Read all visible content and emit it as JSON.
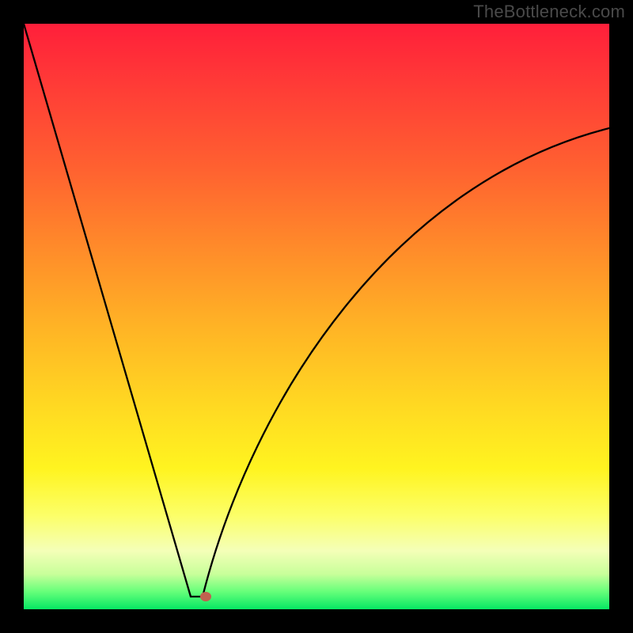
{
  "watermark": "TheBottleneck.com",
  "chart_data": {
    "type": "line",
    "title": "",
    "xlabel": "",
    "ylabel": "",
    "x": [
      0.0,
      0.05,
      0.1,
      0.15,
      0.2,
      0.25,
      0.28,
      0.3,
      0.32,
      0.35,
      0.4,
      0.45,
      0.5,
      0.55,
      0.6,
      0.65,
      0.7,
      0.75,
      0.8,
      0.85,
      0.9,
      0.95,
      1.0
    ],
    "values": [
      100,
      82,
      64,
      46,
      28,
      10,
      2,
      0,
      2,
      11,
      25,
      36,
      45,
      53,
      59,
      64,
      68,
      72,
      75,
      77,
      79,
      80.5,
      82
    ],
    "xlim": [
      0,
      1
    ],
    "ylim": [
      0,
      100
    ],
    "min_flat": {
      "x_start": 0.285,
      "x_end": 0.305,
      "y": 0
    },
    "marker": {
      "x": 0.31,
      "y": 0.5
    },
    "gradient_stops": [
      {
        "pct": 0,
        "color": "#ff1f3a"
      },
      {
        "pct": 50,
        "color": "#ffb425"
      },
      {
        "pct": 80,
        "color": "#fff420"
      },
      {
        "pct": 100,
        "color": "#06e763"
      }
    ]
  }
}
